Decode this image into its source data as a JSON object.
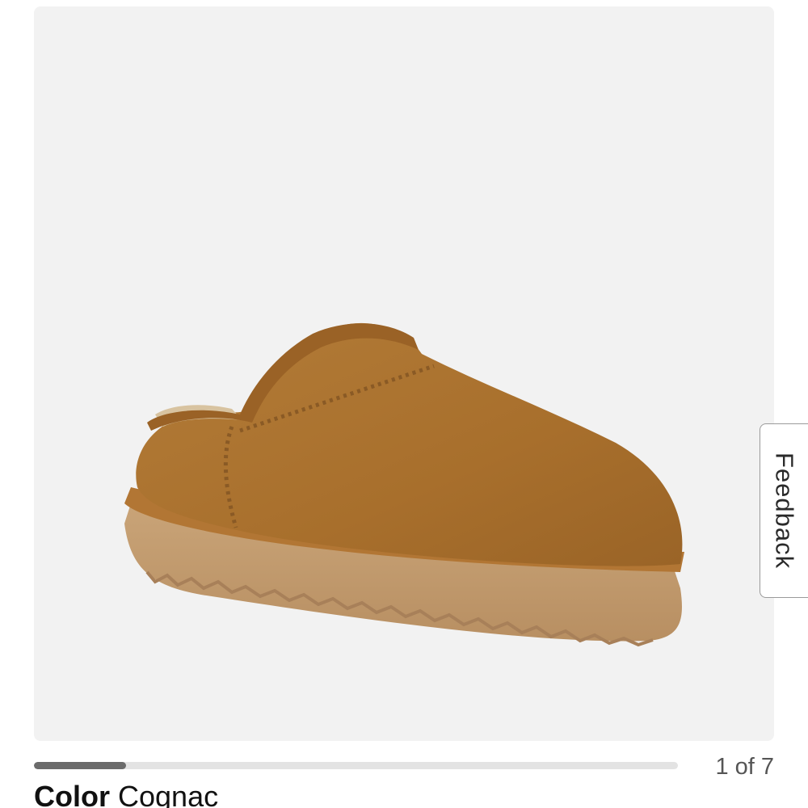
{
  "gallery": {
    "image_alt": "Cognac suede slipper",
    "counter": "1 of 7",
    "current_index": 1,
    "total": 7,
    "progress_fraction": 0.143
  },
  "feedback": {
    "label": "Feedback"
  },
  "color": {
    "label": "Color",
    "value": "Cognac"
  },
  "colors": {
    "image_background": "#f2f2f2",
    "progress_track": "#e3e3e3",
    "progress_fill": "#6b6b6b",
    "suede": "#b07a35",
    "sole": "#c19a6b"
  }
}
